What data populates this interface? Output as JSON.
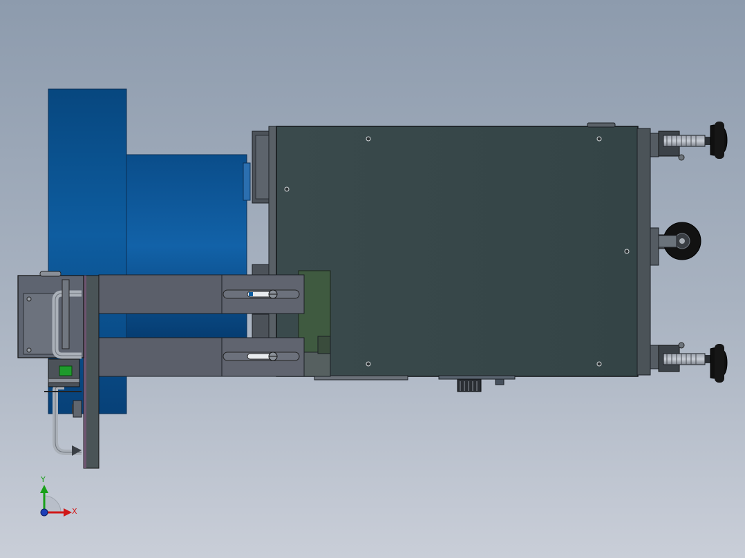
{
  "viewport": {
    "background_top": "#8d9bad",
    "background_bottom": "#c9ced8"
  },
  "colors": {
    "blower_blue": "#0b4f8a",
    "cabinet_green": "#37474a",
    "bracket_gray": "#5c606b",
    "edge_dark": "#1b1f24",
    "pcb_green": "#3f5a40",
    "caster_black": "#111111"
  },
  "triad": {
    "x_label": "X",
    "y_label": "Y",
    "x_color": "#d01818",
    "y_color": "#18a018",
    "origin_color": "#1d3fb8"
  }
}
